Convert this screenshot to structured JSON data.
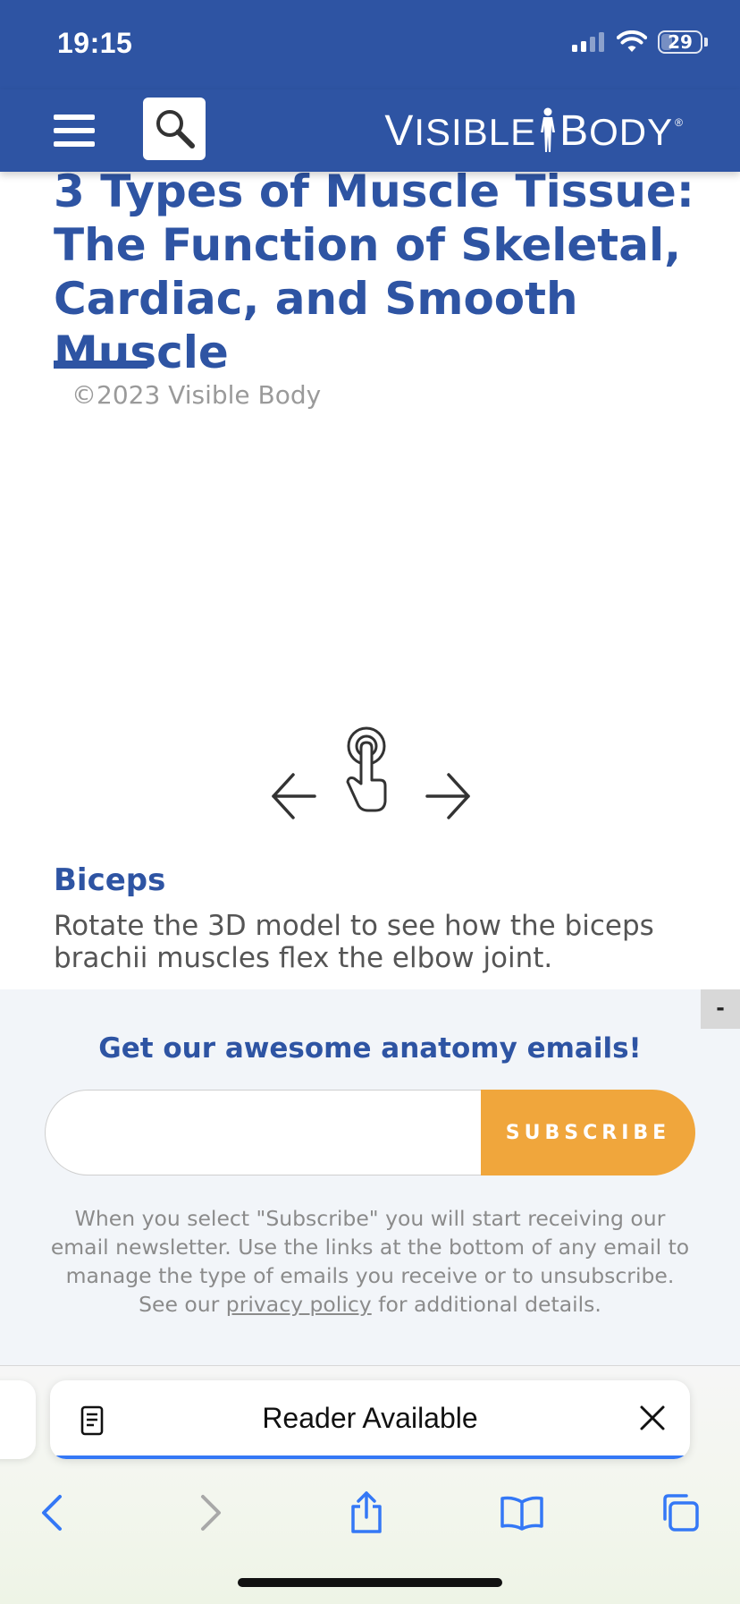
{
  "status_bar": {
    "time": "19:15",
    "battery": "29",
    "battery_level": 0.29
  },
  "header": {
    "logo_first": "V",
    "logo_rest_1": "ISIBLE",
    "logo_second": "B",
    "logo_rest_2": "ODY",
    "logo_mark": "®"
  },
  "article": {
    "title": "3 Types of Muscle Tissue: The Function of Skeletal, Cardiac, and Smooth Muscle",
    "copyright": "©2023 Visible Body",
    "section_title": "Biceps",
    "section_text": "Rotate the 3D model to see how the biceps brachii muscles flex the elbow joint."
  },
  "newsletter": {
    "collapse_label": "-",
    "heading": "Get our awesome anatomy emails!",
    "email_value": "",
    "email_placeholder": "",
    "subscribe_label": "SUBSCRIBE",
    "disclaimer_before": "When you select \"Subscribe\" you will start receiving our email newsletter. Use the links at the bottom of any email to manage the type of emails you receive or to unsubscribe. See our ",
    "privacy_link": "privacy policy",
    "disclaimer_after": " for additional details."
  },
  "browser": {
    "reader_label": "Reader Available",
    "icons": [
      "back-icon",
      "forward-icon",
      "share-icon",
      "bookmarks-icon",
      "tabs-icon"
    ],
    "accent": "#3478f6"
  },
  "colors": {
    "brand_blue": "#2e54a3",
    "subscribe_orange": "#f0a63c",
    "newsletter_bg": "#f2f5f9"
  }
}
